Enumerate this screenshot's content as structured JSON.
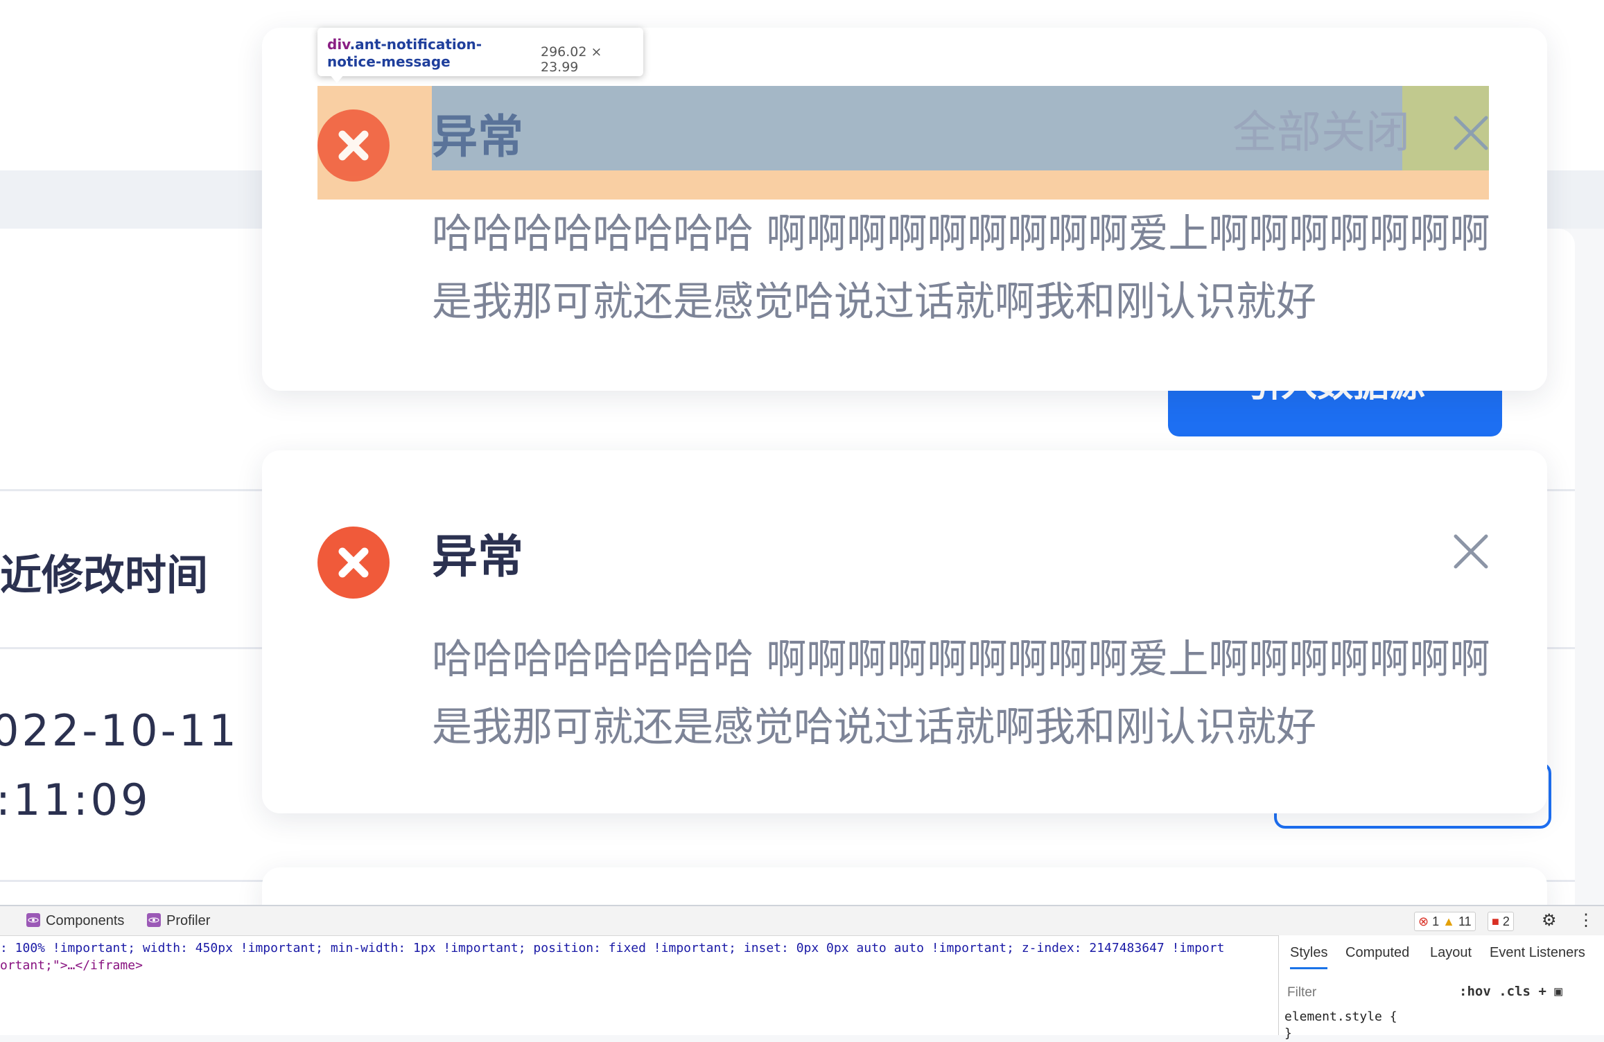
{
  "background": {
    "column_header": "近修改时间",
    "row_date": "022-10-11",
    "row_time": ":11:09",
    "primary_button_label": "引入数据源"
  },
  "notifications": [
    {
      "title": "异常",
      "description": "哈哈哈哈哈哈哈哈 啊啊啊啊啊啊啊啊啊爱上啊啊啊啊啊啊啊是我那可就还是感觉哈说过话就啊我和刚认识就好",
      "close_all_label": "全部关闭",
      "highlighted": true
    },
    {
      "title": "异常",
      "description": "哈哈哈哈哈哈哈哈 啊啊啊啊啊啊啊啊啊爱上啊啊啊啊啊啊啊是我那可就还是感觉哈说过话就啊我和刚认识就好",
      "highlighted": false
    }
  ],
  "inspector_tooltip": {
    "element_tag": "div",
    "element_class": ".ant-notification-notice-message",
    "dimensions": "296.02 × 23.99"
  },
  "devtools": {
    "tabs": [
      "Components",
      "Profiler"
    ],
    "errors": "1",
    "warnings": "11",
    "issues": "2",
    "code_line1": ": 100% !important; width: 450px !important; min-width: 1px !important; position: fixed !important; inset: 0px 0px auto auto !important; z-index: 2147483647 !import",
    "code_line2": "ortant;\">…</iframe>",
    "styles_tabs": [
      "Styles",
      "Computed",
      "Layout",
      "Event Listeners"
    ],
    "filter_placeholder": "Filter",
    "hov_label": ":hov",
    "cls_label": ".cls",
    "element_style": "element.style {\n}"
  },
  "colors": {
    "error_icon": "#f05a3a",
    "primary": "#1d6ff2",
    "highlight_padding": "#f6b26b",
    "highlight_content": "#6fa8dc",
    "highlight_margin": "#93c47d"
  }
}
